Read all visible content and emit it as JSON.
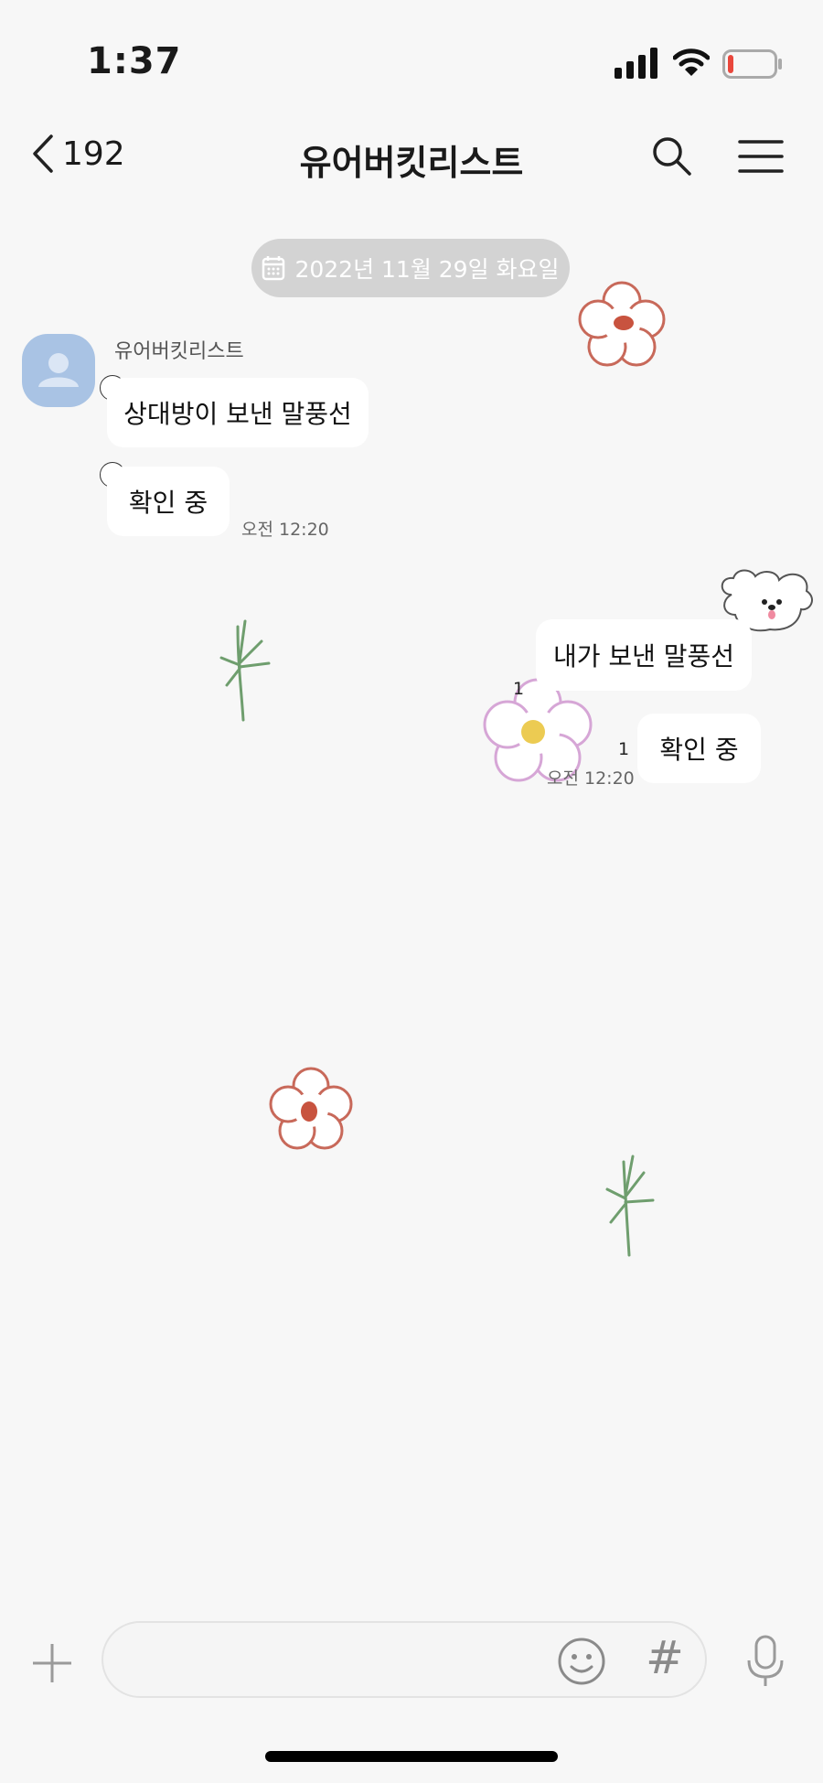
{
  "status_bar": {
    "time": "1:37"
  },
  "header": {
    "back_count": "192",
    "title": "유어버킷리스트"
  },
  "date_divider": "2022년 11월 29일 화요일",
  "incoming": {
    "sender": "유어버킷리스트",
    "messages": [
      "상대방이 보낸 말풍선",
      "확인 중"
    ],
    "time": "오전 12:20"
  },
  "outgoing": {
    "messages": [
      "내가 보낸 말풍선",
      "확인 중"
    ],
    "unread_counts": [
      "1",
      "1"
    ],
    "time": "오전 12:20"
  },
  "input_bar": {
    "hash_label": "#"
  },
  "icons": {
    "back": "chevron-left-icon",
    "search": "search-icon",
    "menu": "hamburger-menu-icon",
    "calendar": "calendar-icon",
    "plus": "plus-icon",
    "emoji": "emoji-icon",
    "mic": "microphone-icon"
  },
  "colors": {
    "background": "#f7f7f7",
    "bubble": "#ffffff",
    "date_pill": "#d3d3d3",
    "avatar": "#a9c3e4",
    "battery_low": "#e9473c"
  },
  "status": {
    "battery_level": 0.12
  }
}
